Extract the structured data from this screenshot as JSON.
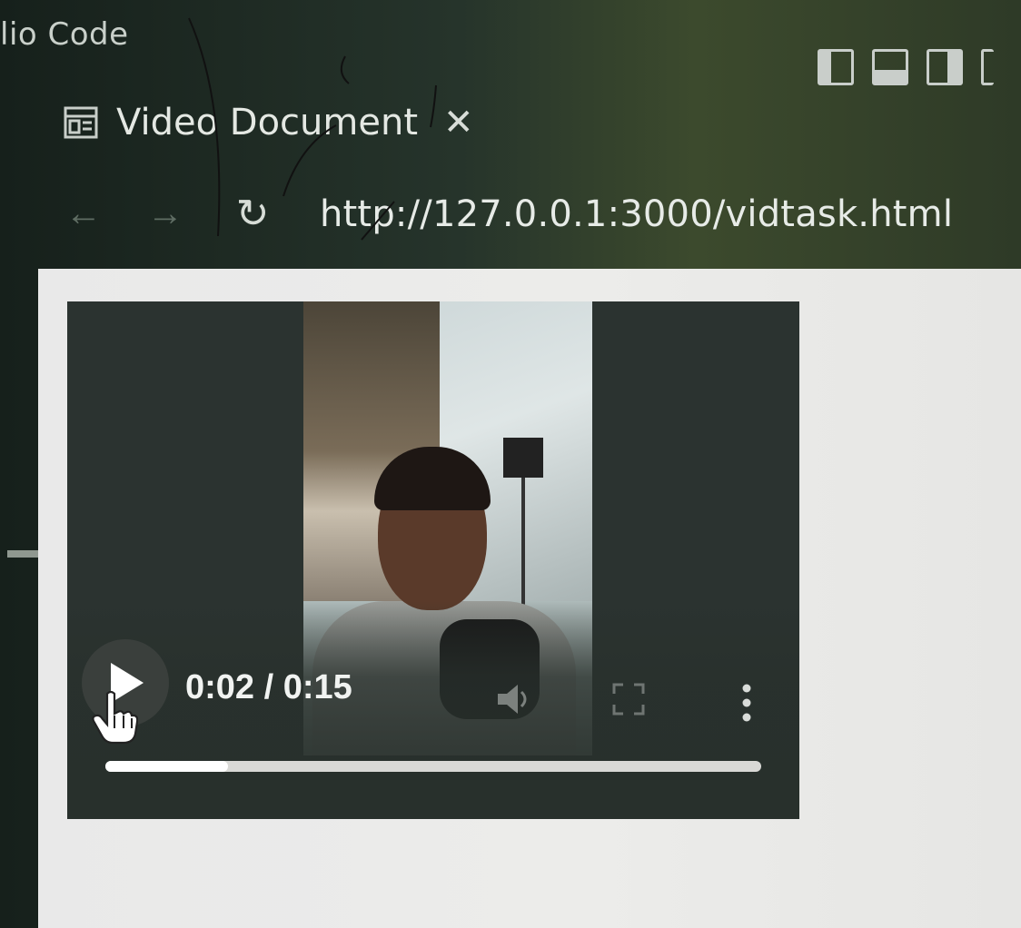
{
  "app": {
    "title_fragment": "lio Code"
  },
  "tab": {
    "title": "Video Document",
    "close_glyph": "✕",
    "icon": "preview-icon"
  },
  "nav": {
    "back_glyph": "←",
    "forward_glyph": "→",
    "reload_glyph": "↻",
    "url": "http://127.0.0.1:3000/vidtask.html"
  },
  "layout_buttons": [
    "toggle-primary-sidebar-icon",
    "toggle-panel-icon",
    "toggle-secondary-sidebar-icon",
    "customize-layout-icon"
  ],
  "video": {
    "time_display": "0:02 / 0:15",
    "progress_fraction": 0.187,
    "state": "paused",
    "icons": [
      "play-icon",
      "volume-icon",
      "fullscreen-icon",
      "more-options-icon"
    ]
  },
  "colors": {
    "page_bg": "#ebebe9",
    "controls_bg": "#2b3330",
    "progress_fill": "#ffffff",
    "progress_track": "#d9d9d6"
  }
}
